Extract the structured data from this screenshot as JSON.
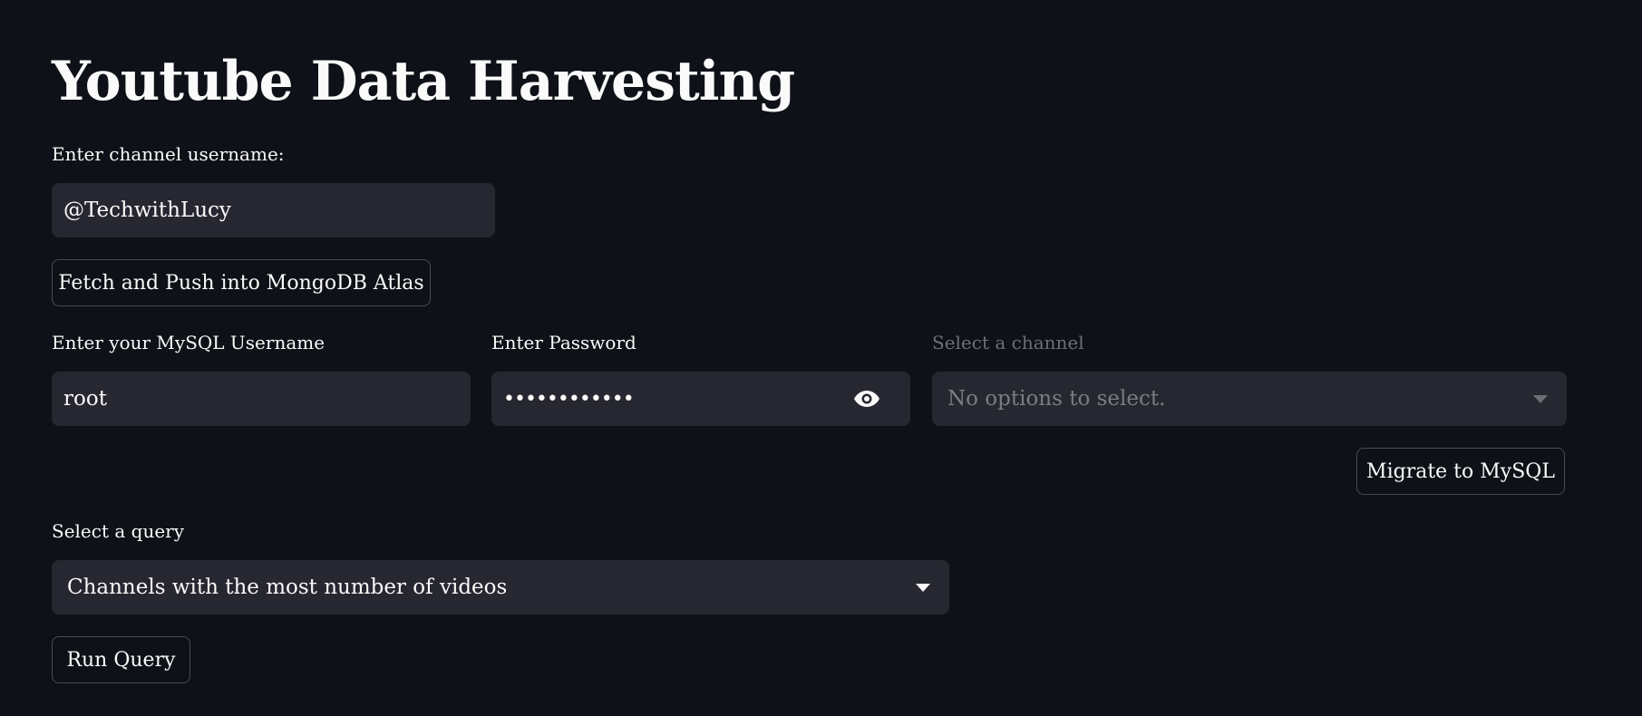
{
  "page_title": "Youtube Data Harvesting",
  "channel_username": {
    "label": "Enter channel username:",
    "value": "@TechwithLucy"
  },
  "fetch_button_label": "Fetch and Push into MongoDB Atlas",
  "mysql": {
    "username_label": "Enter your MySQL Username",
    "username_value": "root",
    "password_label": "Enter Password",
    "password_value": "••••••••••••",
    "channel_label": "Select a channel",
    "channel_placeholder": "No options to select.",
    "migrate_button_label": "Migrate to MySQL"
  },
  "query": {
    "label": "Select a query",
    "selected": "Channels with the most number of videos",
    "run_button_label": "Run Query"
  },
  "icons": {
    "password_toggle": "eye-icon",
    "dropdown": "chevron-down-icon"
  },
  "colors": {
    "background": "#0e1117",
    "input_background": "#262730",
    "text": "#fafafa",
    "disabled_text": "#6d6f76"
  }
}
